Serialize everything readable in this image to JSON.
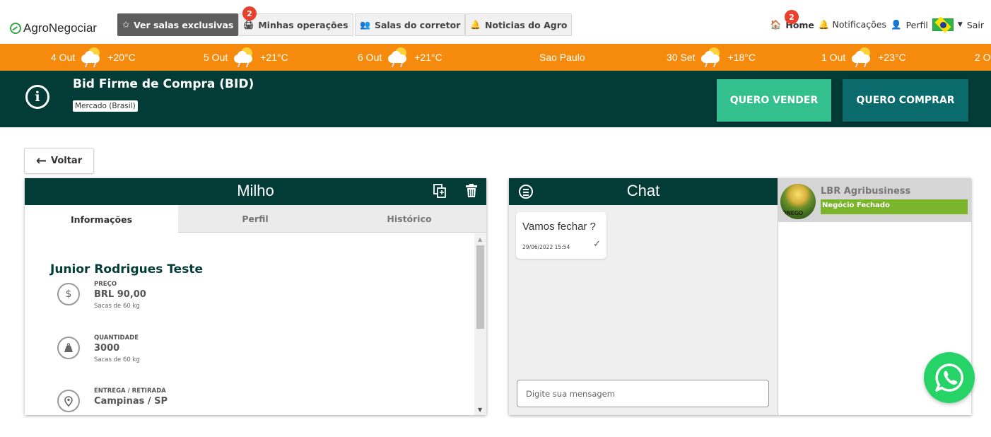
{
  "nav": {
    "brand": "AgroNegociar",
    "exclusive_rooms": "Ver salas exclusivas",
    "my_operations": "Minhas operações",
    "my_operations_badge": "2",
    "broker_rooms": "Salas do corretor",
    "agro_news": "Noticias do Agro",
    "home": "Home",
    "notifications_badge": "2",
    "notifications": "Notificações",
    "profile": "Perfil",
    "logout": "Sair"
  },
  "weather": [
    {
      "date": "4 Out",
      "temp": "+20°C"
    },
    {
      "date": "5 Out",
      "temp": "+21°C"
    },
    {
      "date": "6 Out",
      "temp": "+21°C"
    },
    {
      "city": "Sao Paulo"
    },
    {
      "date": "30 Set",
      "temp": "+18°C"
    },
    {
      "date": "1 Out",
      "temp": "+23°C"
    },
    {
      "date": "2 O"
    }
  ],
  "banner": {
    "title": "Bid Firme de Compra (BID)",
    "market": "Mercado (Brasil)",
    "sell_button": "QUERO VENDER",
    "buy_button": "QUERO COMPRAR"
  },
  "back_label": "Voltar",
  "product": {
    "title": "Milho",
    "tabs": [
      "Informações",
      "Perfil",
      "Histórico"
    ],
    "active_tab": "Informações",
    "name": "Junior Rodrigues Teste",
    "fields": [
      {
        "label": "PREÇO",
        "value": "BRL 90,00",
        "unit": "Sacas de 60 kg",
        "icon": "dollar-icon"
      },
      {
        "label": "QUANTIDADE",
        "value": "3000",
        "unit": "Sacas de 60 kg",
        "icon": "weight-icon"
      },
      {
        "label": "ENTREGA / RETIRADA",
        "value": "Campinas / SP",
        "unit": "",
        "icon": "location-pin-icon"
      }
    ]
  },
  "chat": {
    "title": "Chat",
    "message_text": "Vamos fechar ?",
    "message_time": "29/06/2022 15:54",
    "message_status_icon": "check-icon",
    "input_placeholder": "Digite sua mensagem",
    "contact_name": "LBR Agribusiness",
    "contact_status": "Negócio Fechado"
  },
  "colors": {
    "dark_teal": "#033b37",
    "orange": "#f58a0c",
    "sell_green": "#33c08e",
    "buy_teal": "#0b6b6c",
    "status_green": "#7ab52c",
    "whatsapp_green": "#25d366",
    "badge_red": "#e8402c"
  }
}
